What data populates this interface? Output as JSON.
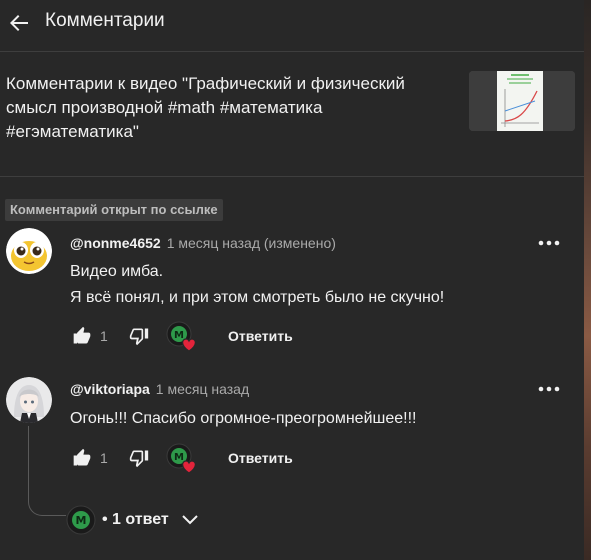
{
  "header": {
    "title": "Комментарии"
  },
  "video": {
    "title": "Комментарии к видео \"Графический и физический смысл производной #math #математика #егэматематика\""
  },
  "linked_badge": "Комментарий открыт по ссылке",
  "comments": [
    {
      "author": "@nonme4652",
      "time": "1 месяц назад (изменено)",
      "lines": [
        "Видео имба.",
        "Я всё понял, и при этом смотреть было не скучно!"
      ],
      "likes": "1",
      "reply_label": "Ответить"
    },
    {
      "author": "@viktoriapa",
      "time": "1 месяц назад",
      "lines": [
        "Огонь!!! Спасибо огромное-преогромнейшее!!!"
      ],
      "likes": "1",
      "reply_label": "Ответить"
    }
  ],
  "replies": {
    "label": "• 1 ответ"
  },
  "colors": {
    "background": "#282828",
    "text": "#f1f1f1",
    "muted": "#aaaaaa",
    "heart": "#e3243b",
    "creator_avatar": "#1f7a3a"
  },
  "icons": [
    "back-arrow-icon",
    "more-vert-icon",
    "thumb-up-icon",
    "thumb-down-icon",
    "creator-heart-icon",
    "chevron-down-icon"
  ]
}
